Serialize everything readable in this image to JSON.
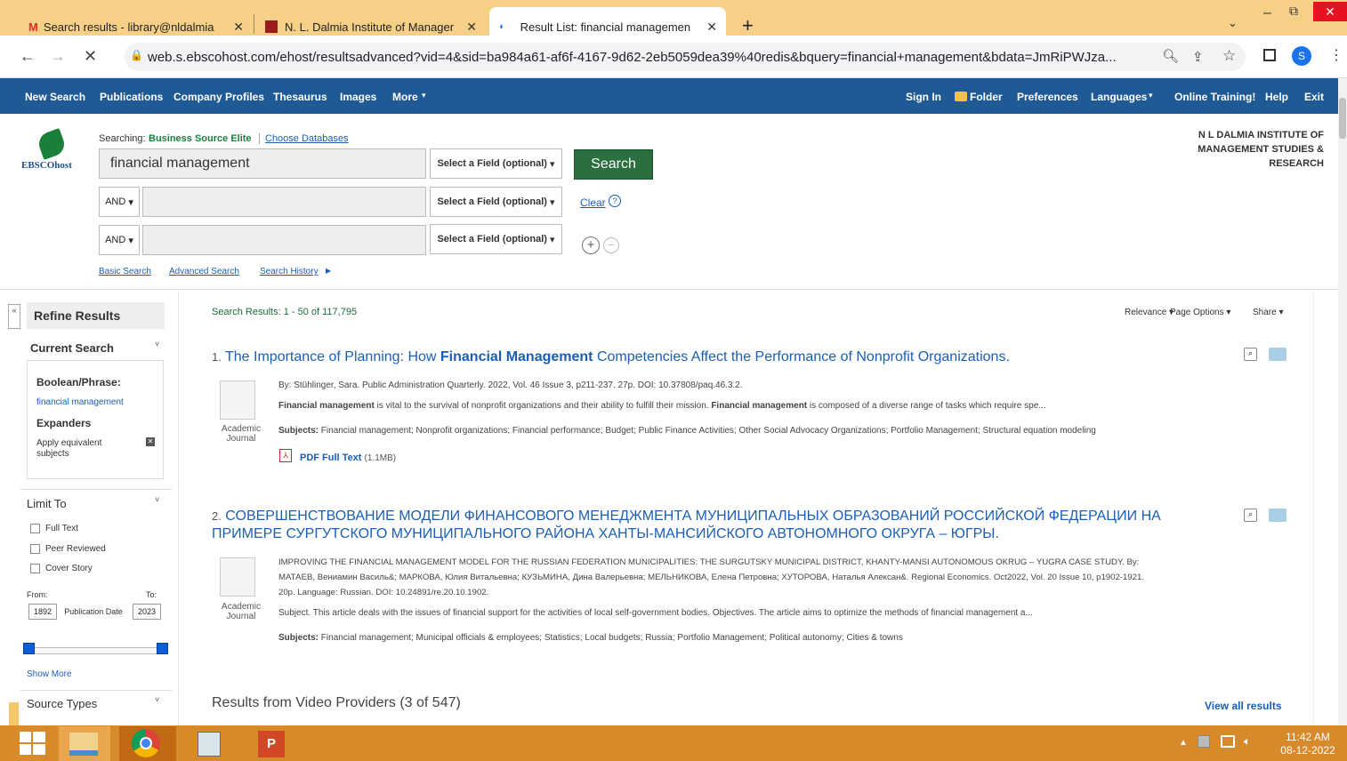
{
  "browser": {
    "tabs": [
      {
        "title": "Search results - library@nldalmia"
      },
      {
        "title": "N. L. Dalmia Institute of Manager"
      },
      {
        "title": "Result List: financial managemen"
      }
    ],
    "new_tab": "+",
    "url": "web.s.ebscohost.com/ehost/resultsadvanced?vid=4&sid=ba984a61-af6f-4167-9d62-2eb5059dea39%40redis&bquery=financial+management&bdata=JmRiPWJza...",
    "profile_initial": "S"
  },
  "toolbar": {
    "left": [
      "New Search",
      "Publications",
      "Company Profiles",
      "Thesaurus",
      "Images",
      "More"
    ],
    "right": [
      "Sign In",
      "Folder",
      "Preferences",
      "Languages",
      "Online Training!",
      "Help",
      "Exit"
    ]
  },
  "search": {
    "searching_label": "Searching:",
    "database": "Business Source Elite",
    "choose_db": "Choose Databases",
    "query": "financial management",
    "field_select": "Select a Field (optional)",
    "bool": "AND",
    "search_btn": "Search",
    "clear": "Clear",
    "links": [
      "Basic Search",
      "Advanced Search",
      "Search History"
    ],
    "logo": "EBSCOhost",
    "institution": [
      "N L DALMIA INSTITUTE OF",
      "MANAGEMENT STUDIES &",
      "RESEARCH"
    ]
  },
  "sidebar": {
    "refine": "Refine Results",
    "current_search": "Current Search",
    "boolean_label": "Boolean/Phrase:",
    "boolean_value": "financial management",
    "expanders": "Expanders",
    "apply_equiv": "Apply equivalent subjects",
    "limit_to": "Limit To",
    "limits": [
      "Full Text",
      "Peer Reviewed",
      "Cover Story"
    ],
    "from": "From:",
    "to": "To:",
    "from_val": "1892",
    "to_val": "2023",
    "pub_date": "Publication Date",
    "show_more": "Show More",
    "source_types": "Source Types"
  },
  "results": {
    "summary": "Search Results: 1 - 50 of 117,795",
    "sort": "Relevance",
    "page_options": "Page Options",
    "share": "Share",
    "items": [
      {
        "num": "1.",
        "title_a": "The Importance of Planning: How ",
        "title_b": "Financial Management",
        "title_c": " Competencies Affect the Performance of Nonprofit Organizations.",
        "byline": "By: Stühlinger, Sara. Public Administration Quarterly. 2022, Vol. 46 Issue 3, p211-237. 27p. DOI: 10.37808/paq.46.3.2.",
        "abstract_b": "Financial management",
        "abstract": " is vital to the survival of nonprofit organizations and their ability to fulfill their mission. ",
        "abstract_b2": "Financial management",
        "abstract2": " is composed of a diverse range of tasks which require spe...",
        "subjects_label": "Subjects: ",
        "subjects": "Financial management; Nonprofit organizations; Financial performance; Budget; Public Finance Activities; Other Social Advocacy Organizations; Portfolio Management; Structural equation modeling",
        "type_a": "Academic",
        "type_b": "Journal",
        "pdf": "PDF Full Text",
        "pdf_size": "(1.1MB)"
      },
      {
        "num": "2.",
        "title": "СОВЕРШЕНСТВОВАНИЕ МОДЕЛИ ФИНАНСОВОГО МЕНЕДЖМЕНТА МУНИЦИПАЛЬНЫХ ОБРАЗОВАНИЙ РОССИЙСКОЙ ФЕДЕРАЦИИ НА",
        "title2": "ПРИМЕРЕ СУРГУТСКОГО МУНИЦИПАЛЬНОГО РАЙОНА ХАНТЫ-МАНСИЙСКОГО АВТОНОМНОГО ОКРУГА – ЮГРЫ.",
        "line1": "IMPROVING THE FINANCIAL MANAGEMENT MODEL FOR THE RUSSIAN FEDERATION MUNICIPALITIES: THE SURGUTSKY MUNICIPAL DISTRICT, KHANTY-MANSI AUTONOMOUS OKRUG – YUGRA CASE STUDY. By:",
        "line2": "МАТАЕВ, Вениамин Василь&; МАРКОВА, Юлия Витальевна; КУЗЬМИНА, Дина Валерьевна; МЕЛЬНИКОВА, Елена Петровна; ХУТОРОВА, Наталья Алексан&. Regional Economics. Oct2022, Vol. 20 Issue 10, p1902-1921.",
        "line3": "20p. Language: Russian. DOI: 10.24891/re.20.10.1902.",
        "abstract": "Subject. This article deals with the issues of financial support for the activities of local self-government bodies. Objectives. The article aims to optimize the methods of financial management a...",
        "subjects_label": "Subjects: ",
        "subjects": "Financial management; Municipal officials & employees; Statistics; Local budgets; Russia; Portfolio Management; Political autonomy; Cities & towns",
        "type_a": "Academic",
        "type_b": "Journal"
      }
    ],
    "video_heading": "Results from Video Providers (3 of 547)",
    "view_all": "View all results"
  },
  "taskbar": {
    "time": "11:42 AM",
    "date": "08-12-2022"
  }
}
